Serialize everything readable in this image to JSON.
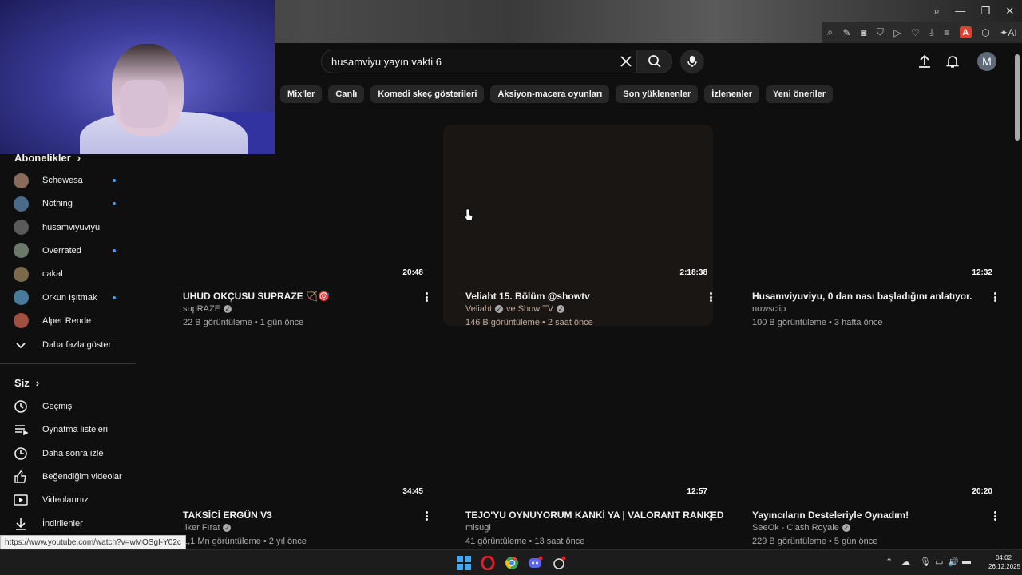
{
  "browser": {
    "ext_letter": "A",
    "ai_label": "AI"
  },
  "search": {
    "query": "husamviyu yayın vakti 6"
  },
  "header": {
    "avatar_letter": "M"
  },
  "chips": [
    "Mix'ler",
    "Canlı",
    "Komedi skeç gösterileri",
    "Aksiyon-macera oyunları",
    "Son yüklenenler",
    "İzlenenler",
    "Yeni öneriler"
  ],
  "sidebar": {
    "subscriptions_title": "Abonelikler",
    "subscriptions": [
      {
        "label": "Schewesa",
        "new": true,
        "color": "#8a6a5a"
      },
      {
        "label": "Nothing",
        "new": true,
        "color": "#4a6a8a"
      },
      {
        "label": "husamviyuviyu",
        "new": false,
        "color": "#5a5a5a"
      },
      {
        "label": "Overrated",
        "new": true,
        "color": "#6a7a6a"
      },
      {
        "label": "cakal",
        "new": false,
        "color": "#7a6a4a"
      },
      {
        "label": "Orkun Işıtmak",
        "new": true,
        "color": "#4a7a9a"
      },
      {
        "label": "Alper Rende",
        "new": false,
        "color": "#a05040"
      }
    ],
    "show_more": "Daha fazla göster",
    "you_title": "Siz",
    "you_items": [
      {
        "label": "Geçmiş",
        "icon": "history-icon"
      },
      {
        "label": "Oynatma listeleri",
        "icon": "playlists-icon"
      },
      {
        "label": "Daha sonra izle",
        "icon": "watch-later-icon"
      },
      {
        "label": "Beğendiğim videolar",
        "icon": "like-icon"
      },
      {
        "label": "Videolarınız",
        "icon": "your-videos-icon"
      },
      {
        "label": "İndirilenler",
        "icon": "download-icon"
      }
    ]
  },
  "videos": [
    {
      "title": "UHUD OKÇUSU SUPRAZE 🏹🎯",
      "channel": "supRAZE",
      "verified": true,
      "meta": "22 B görüntüleme • 1 gün önce",
      "duration": "20:48"
    },
    {
      "title": "Veliaht 15. Bölüm @showtv",
      "channel": "Veliaht",
      "channel_extra": "ve Show TV",
      "verified": true,
      "meta": "146 B görüntüleme • 2 saat önce",
      "duration": "2:18:38"
    },
    {
      "title": "Husamviyuviyu, 0 dan nası başladığını anlatıyor.",
      "channel": "nowsclip",
      "verified": false,
      "meta": "100 B görüntüleme • 3 hafta önce",
      "duration": "12:32"
    },
    {
      "title": "TAKSİCİ ERGÜN V3",
      "channel": "İlker Fırat",
      "verified": true,
      "meta": "1,1 Mn görüntüleme • 2 yıl önce",
      "duration": "34:45"
    },
    {
      "title": "TEJO'YU OYNUYORUM KANKİ YA | VALORANT RANKED",
      "channel": "misugi",
      "verified": false,
      "meta": "41 görüntüleme • 13 saat önce",
      "duration": "12:57"
    },
    {
      "title": "Yayıncıların Desteleriyle Oynadım!",
      "channel": "SeeOk - Clash Royale",
      "verified": true,
      "meta": "229 B görüntüleme • 5 gün önce",
      "duration": "20:20"
    }
  ],
  "status_url": "https://www.youtube.com/watch?v=wMOSgI-Y02c",
  "clock": {
    "time": "04:02",
    "date": "26.12.2025"
  }
}
